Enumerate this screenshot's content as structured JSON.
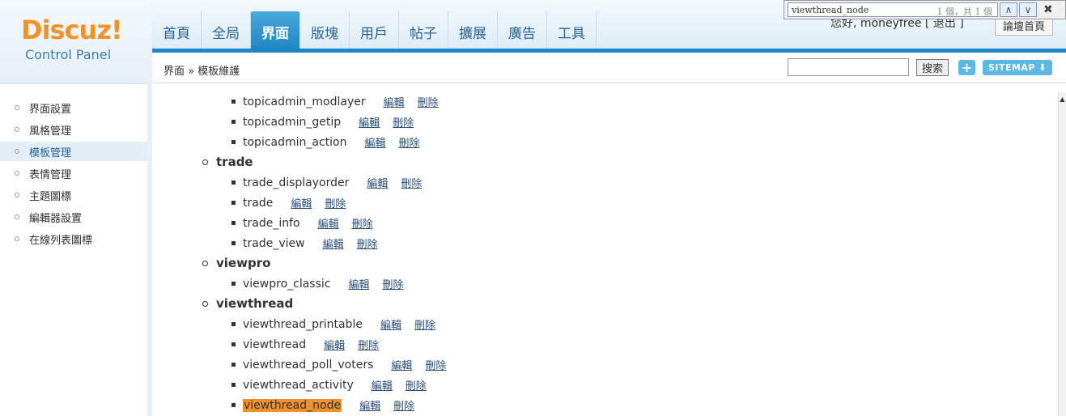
{
  "findbar": {
    "query": "viewthread_node",
    "count": "1 個，共 1 個",
    "prev_icon": "chevron-up-icon",
    "next_icon": "chevron-down-icon",
    "close_icon": "close-icon"
  },
  "logo": {
    "main": "Discuz!",
    "sub": "Control Panel"
  },
  "nav": [
    "首頁",
    "全局",
    "界面",
    "版塊",
    "用戶",
    "帖子",
    "擴展",
    "廣告",
    "工具"
  ],
  "nav_active": "界面",
  "header": {
    "userinfo": "您好, moneyfree [ 退出 ]",
    "forum_home": "論壇首頁"
  },
  "breadcrumb": "界面 » 模板維護",
  "search": {
    "button": "搜索",
    "plus": "+",
    "sitemap": "SITEMAP ⬇"
  },
  "sidebar": [
    {
      "label": "界面設置"
    },
    {
      "label": "風格管理"
    },
    {
      "label": "模板管理",
      "active": true
    },
    {
      "label": "表情管理"
    },
    {
      "label": "主題圖標"
    },
    {
      "label": "編輯器設置"
    },
    {
      "label": "在線列表圖標"
    }
  ],
  "tree": {
    "edit_label": "編輯",
    "delete_label": "刪除",
    "top_items": [
      "topicadmin_modlayer",
      "topicadmin_getip",
      "topicadmin_action"
    ],
    "groups": [
      {
        "name": "trade",
        "items": [
          "trade_displayorder",
          "trade",
          "trade_info",
          "trade_view"
        ]
      },
      {
        "name": "viewpro",
        "items": [
          "viewpro_classic"
        ]
      },
      {
        "name": "viewthread",
        "items": [
          "viewthread_printable",
          "viewthread",
          "viewthread_poll_voters",
          "viewthread_activity",
          "viewthread_node"
        ]
      }
    ],
    "highlighted": "viewthread_node"
  },
  "colors": {
    "accent": "#1d86c4",
    "logo": "#f0932b",
    "highlight": "#f0902c"
  }
}
